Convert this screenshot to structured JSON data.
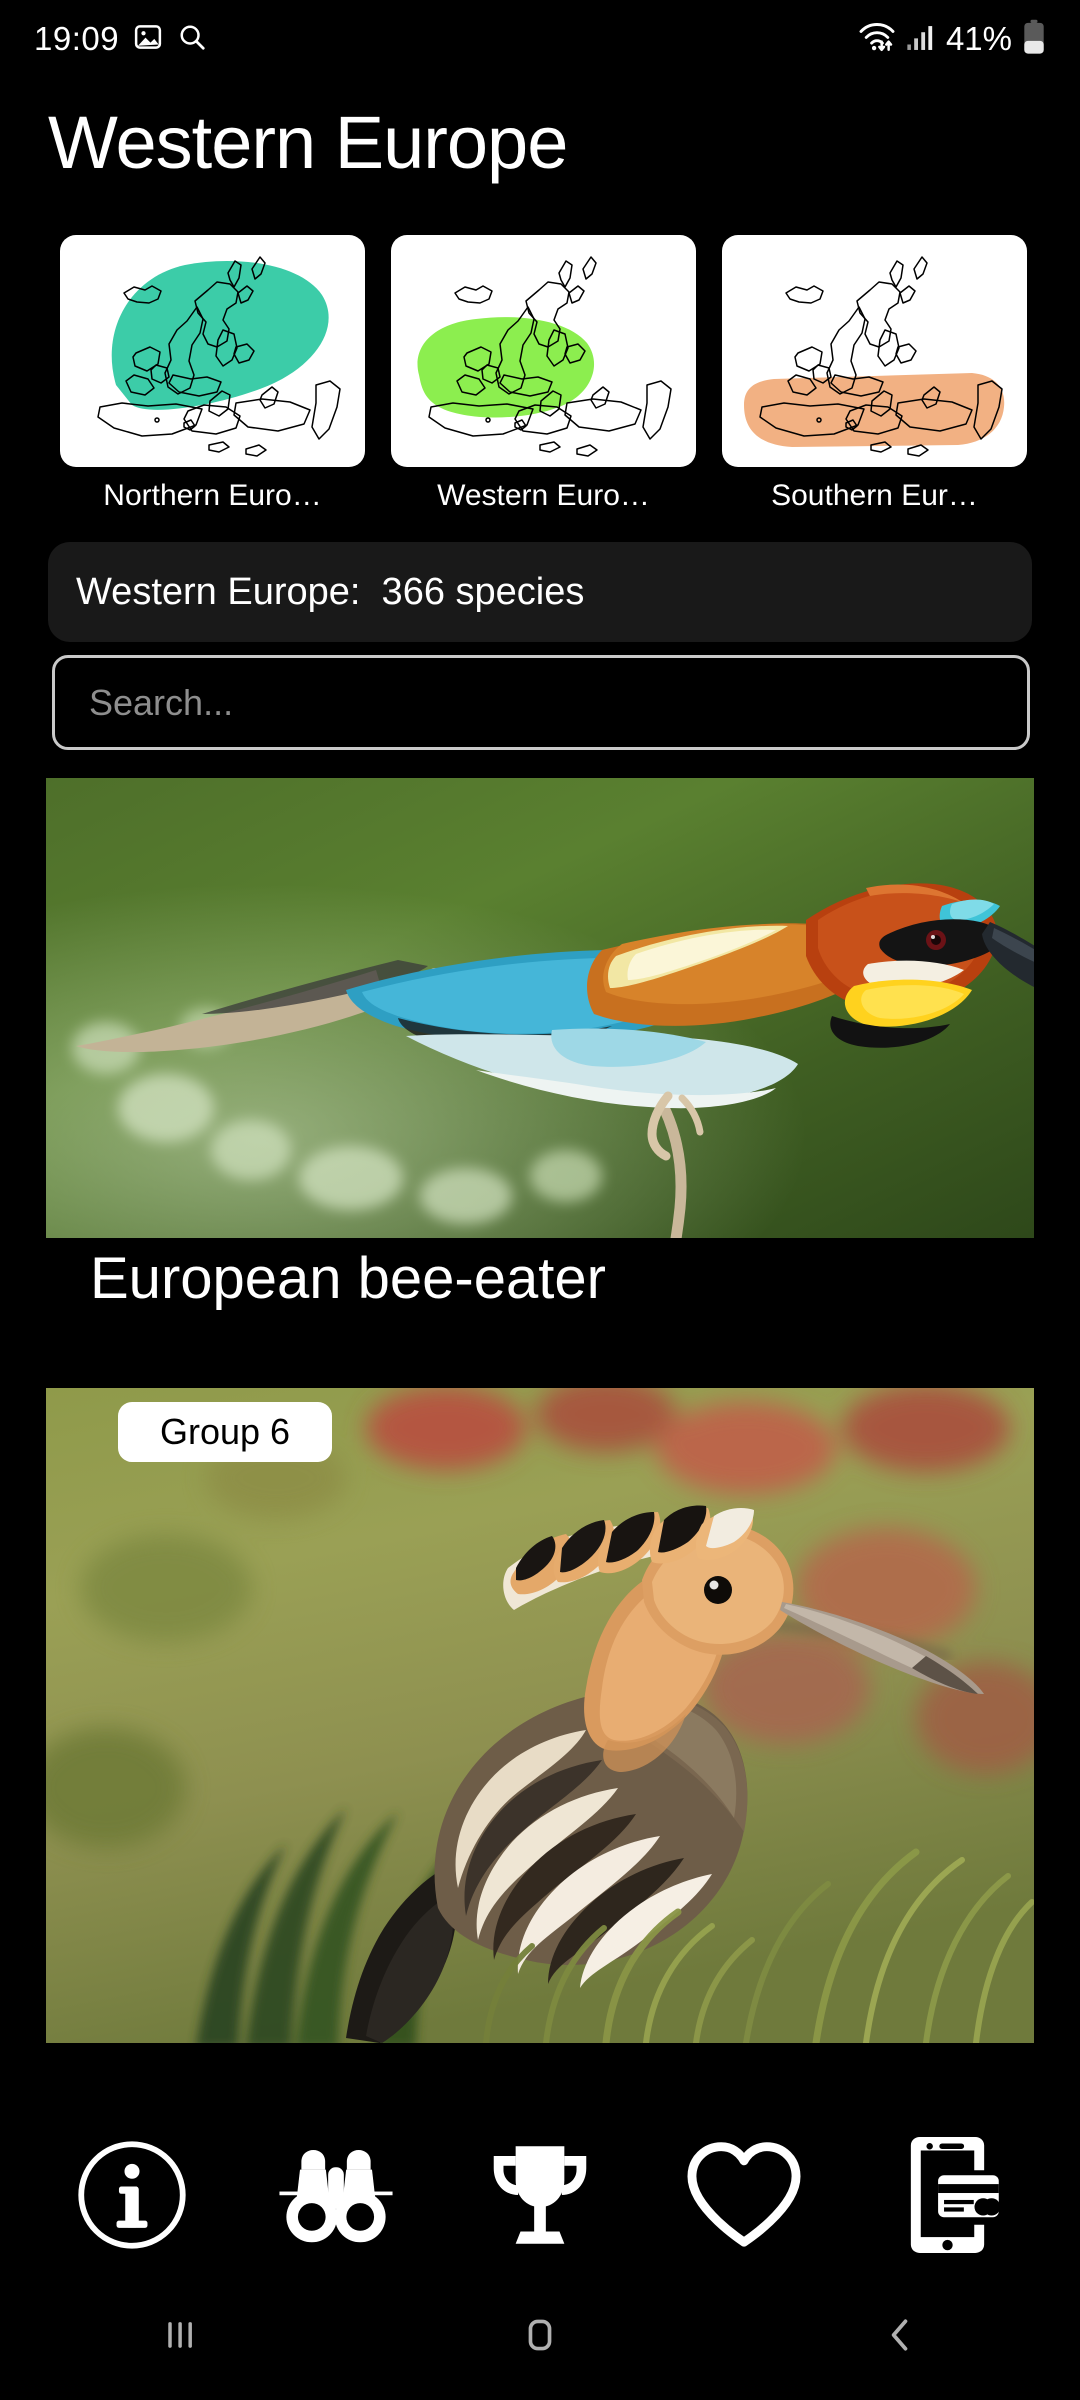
{
  "status_bar": {
    "time": "19:09",
    "left_icons": [
      "image-icon",
      "search-icon"
    ],
    "battery_percent": "41%",
    "right_icons": [
      "wifi-icon",
      "signal-icon",
      "battery-icon"
    ]
  },
  "header": {
    "title": "Western Europe"
  },
  "regions": [
    {
      "label": "Northern Euro…",
      "color": "#3ccca8",
      "key": "northern-europe"
    },
    {
      "label": "Western Euro…",
      "color": "#8cee4f",
      "key": "western-europe"
    },
    {
      "label": "Southern Eur…",
      "color": "#f2b183",
      "key": "southern-europe"
    }
  ],
  "count_bar": {
    "text": "Western Europe:  366 species",
    "region": "Western Europe",
    "species_count": "366",
    "background": "#191919"
  },
  "search": {
    "value": "",
    "placeholder": "Search..."
  },
  "species": [
    {
      "name": "European bee-eater",
      "badge": "",
      "photo_alt": "European bee-eater perched on a thin branch, green blurred background"
    },
    {
      "name": "",
      "badge": "Group 6",
      "photo_alt": "Eurasian hoopoe standing in dry grass, orange crest with black tips"
    }
  ],
  "toolbar": [
    {
      "icon": "info-icon",
      "key": "info"
    },
    {
      "icon": "binoculars-icon",
      "key": "observations"
    },
    {
      "icon": "trophy-icon",
      "key": "achievements"
    },
    {
      "icon": "heart-icon",
      "key": "favourites"
    },
    {
      "icon": "phone-card-icon",
      "key": "support"
    }
  ],
  "navbar": [
    {
      "icon": "recents-icon",
      "key": "recents"
    },
    {
      "icon": "home-icon",
      "key": "home"
    },
    {
      "icon": "back-icon",
      "key": "back"
    }
  ],
  "theme": {
    "background": "#000000",
    "text": "#ffffff",
    "muted_text": "#8e8e8e",
    "card_background": "#191919",
    "border": "#c9c9c9"
  }
}
